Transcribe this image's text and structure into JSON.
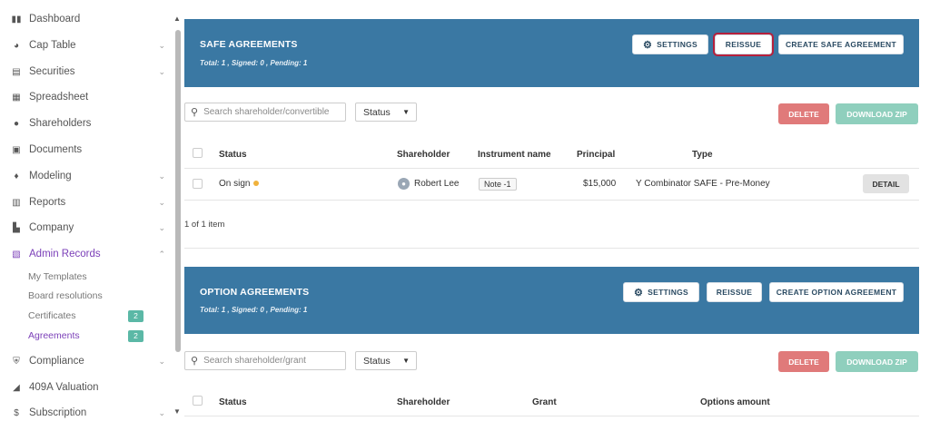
{
  "sidebar": {
    "items": [
      {
        "label": "Dashboard",
        "icon": "dashboard-icon",
        "glyph": "▮▮",
        "chevron": ""
      },
      {
        "label": "Cap Table",
        "icon": "pie-chart-icon",
        "glyph": "◕",
        "chevron": "⌄"
      },
      {
        "label": "Securities",
        "icon": "clipboard-icon",
        "glyph": "▤",
        "chevron": "⌄"
      },
      {
        "label": "Spreadsheet",
        "icon": "spreadsheet-icon",
        "glyph": "▦",
        "chevron": ""
      },
      {
        "label": "Shareholders",
        "icon": "person-icon",
        "glyph": "●",
        "chevron": ""
      },
      {
        "label": "Documents",
        "icon": "document-icon",
        "glyph": "▣",
        "chevron": ""
      },
      {
        "label": "Modeling",
        "icon": "lightbulb-icon",
        "glyph": "♦",
        "chevron": "⌄"
      },
      {
        "label": "Reports",
        "icon": "report-icon",
        "glyph": "▥",
        "chevron": "⌄"
      },
      {
        "label": "Company",
        "icon": "building-icon",
        "glyph": "▙",
        "chevron": "⌄"
      },
      {
        "label": "Admin Records",
        "icon": "admin-records-icon",
        "glyph": "▧",
        "chevron": "⌃"
      }
    ],
    "subitems": [
      {
        "label": "My Templates",
        "badge": ""
      },
      {
        "label": "Board resolutions",
        "badge": ""
      },
      {
        "label": "Certificates",
        "badge": "2"
      },
      {
        "label": "Agreements",
        "badge": "2"
      }
    ],
    "items_after": [
      {
        "label": "Compliance",
        "icon": "shield-icon",
        "glyph": "⛨",
        "chevron": "⌄"
      },
      {
        "label": "409A Valuation",
        "icon": "chart-icon",
        "glyph": "◢",
        "chevron": ""
      },
      {
        "label": "Subscription",
        "icon": "dollar-icon",
        "glyph": "$",
        "chevron": "⌄"
      }
    ]
  },
  "safe": {
    "title": "SAFE AGREEMENTS",
    "meta": "Total: 1 , Signed: 0 , Pending: 1",
    "settings_label": "SETTINGS",
    "reissue_label": "REISSUE",
    "create_label": "CREATE SAFE AGREEMENT",
    "search_placeholder": "Search shareholder/convertible",
    "status_label": "Status",
    "delete_label": "DELETE",
    "zip_label": "DOWNLOAD ZIP",
    "columns": [
      "Status",
      "Shareholder",
      "Instrument name",
      "Principal",
      "Type"
    ],
    "rows": [
      {
        "status": "On sign",
        "shareholder": "Robert Lee",
        "instrument": "Note -1",
        "principal": "$15,000",
        "type": "Y Combinator SAFE - Pre-Money",
        "action": "DETAIL"
      }
    ],
    "pager": "1 of 1 item"
  },
  "option": {
    "title": "OPTION AGREEMENTS",
    "meta": "Total: 1 , Signed: 0 , Pending: 1",
    "settings_label": "SETTINGS",
    "reissue_label": "REISSUE",
    "create_label": "CREATE OPTION AGREEMENT",
    "search_placeholder": "Search shareholder/grant",
    "status_label": "Status",
    "delete_label": "DELETE",
    "zip_label": "DOWNLOAD ZIP",
    "columns": [
      "Status",
      "Shareholder",
      "Grant",
      "Options amount"
    ]
  },
  "colors": {
    "banner": "#3a78a3",
    "accent": "#7b3fb8",
    "delete": "#e07a7a",
    "zip": "#8fcfbd",
    "highlight": "#b6203c",
    "pending_dot": "#f0b23c"
  }
}
